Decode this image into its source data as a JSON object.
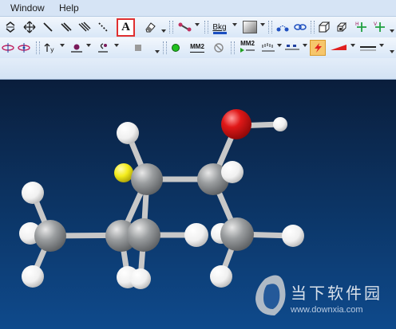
{
  "menu": {
    "items": [
      {
        "label": "Window"
      },
      {
        "label": "Help"
      }
    ]
  },
  "toolbar": {
    "text_tool_label": "A",
    "mm2_label": "MM2",
    "mm2_run_label": "MM2",
    "bkg_label": "Bkg"
  },
  "watermark": {
    "title": "当下软件园",
    "url": "www.downxia.com"
  },
  "colors": {
    "viewport_top": "#0a1e3c",
    "viewport_bottom": "#0e4a8c",
    "carbon": "#8a8d90",
    "hydrogen": "#ffffff",
    "oxygen": "#e01818",
    "sulfur": "#f4ec1c",
    "bond": "#c8c8c8",
    "highlight": "#e03030"
  }
}
